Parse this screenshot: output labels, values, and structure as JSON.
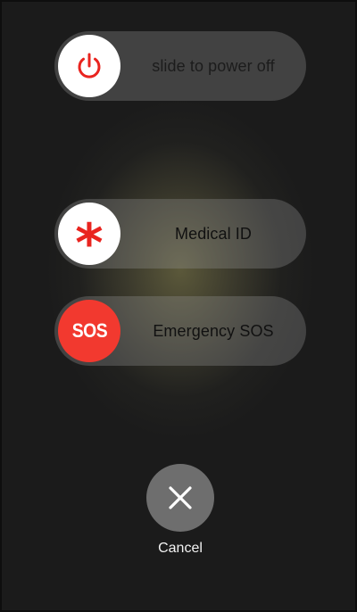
{
  "power_slider": {
    "label": "slide to power off",
    "icon": "power-icon",
    "icon_color": "#e9241f"
  },
  "medical_slider": {
    "label": "Medical ID",
    "icon": "asterisk-icon",
    "icon_glyph": "*",
    "icon_color": "#e9241f"
  },
  "sos_slider": {
    "label": "Emergency SOS",
    "icon_text": "SOS",
    "icon_bg": "#f2392f"
  },
  "cancel": {
    "label": "Cancel",
    "icon": "close-icon"
  }
}
